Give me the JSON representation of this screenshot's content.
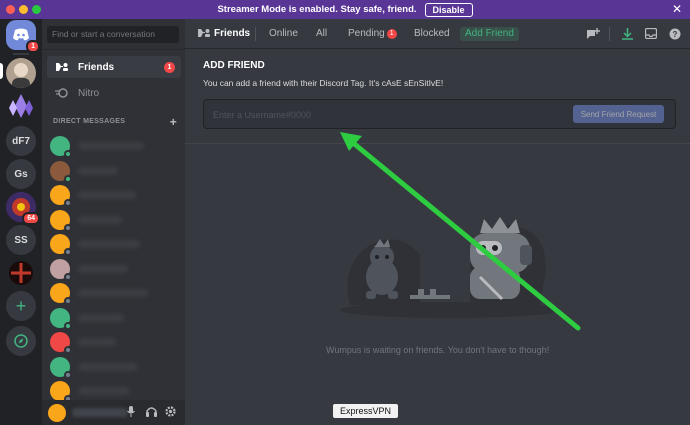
{
  "banner": {
    "text": "Streamer Mode is enabled. Stay safe, friend.",
    "disable_label": "Disable"
  },
  "window_controls": {
    "red": "#ff5f57",
    "yellow": "#febc2e",
    "green": "#28c840"
  },
  "servers": [
    {
      "label": "",
      "kind": "home",
      "badge": "1"
    },
    {
      "label": "",
      "kind": "avatar"
    },
    {
      "label": "",
      "kind": "crystal"
    },
    {
      "label": "dF7",
      "kind": "text"
    },
    {
      "label": "Gs",
      "kind": "text"
    },
    {
      "label": "",
      "kind": "image",
      "badge": "64"
    },
    {
      "label": "SS",
      "kind": "text"
    },
    {
      "label": "",
      "kind": "image2"
    },
    {
      "label": "+",
      "kind": "add"
    },
    {
      "label": "",
      "kind": "explore"
    }
  ],
  "sidebar": {
    "search_placeholder": "Find or start a conversation",
    "friends_label": "Friends",
    "friends_badge": "1",
    "nitro_label": "Nitro",
    "dm_header": "DIRECT MESSAGES",
    "dm_avatar_colors": [
      "#43b581",
      "#8b5a3c",
      "#faa61a",
      "#faa61a",
      "#faa61a",
      "#c0a0a0",
      "#faa61a",
      "#43b581",
      "#f04747",
      "#43b581",
      "#faa61a",
      "#55bff0"
    ]
  },
  "topbar": {
    "title": "Friends",
    "tabs": {
      "online": "Online",
      "all": "All",
      "pending": "Pending",
      "pending_badge": "1",
      "blocked": "Blocked",
      "add_friend": "Add Friend"
    }
  },
  "add_friend": {
    "header": "ADD FRIEND",
    "description": "You can add a friend with their Discord Tag. It's cAsE sEnSitIvE!",
    "input_placeholder": "Enter a Username#0000",
    "send_label": "Send Friend Request"
  },
  "empty_state": {
    "text": "Wumpus is waiting on friends. You don't have to though!"
  },
  "tooltip": {
    "text": "ExpressVPN"
  },
  "colors": {
    "blurple": "#7289da",
    "green": "#43b581",
    "red": "#f04747",
    "arrow": "#2ecc40"
  }
}
